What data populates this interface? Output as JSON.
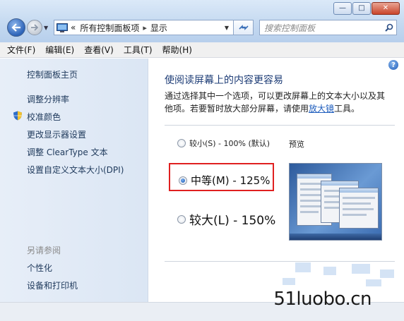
{
  "window": {
    "minimize_glyph": "—",
    "maximize_glyph": "□",
    "close_glyph": "✕"
  },
  "nav": {
    "breadcrumb_sep": "«",
    "breadcrumb_1": "所有控制面板项",
    "breadcrumb_arrow": "▸",
    "breadcrumb_2": "显示",
    "search_placeholder": "搜索控制面板"
  },
  "menu": {
    "file": "文件(F)",
    "edit": "编辑(E)",
    "view": "查看(V)",
    "tools": "工具(T)",
    "help": "帮助(H)"
  },
  "sidebar": {
    "home": "控制面板主页",
    "resolution": "调整分辨率",
    "calibrate": "校准颜色",
    "display_settings": "更改显示器设置",
    "cleartype": "调整 ClearType 文本",
    "custom_dpi": "设置自定义文本大小(DPI)",
    "see_also": "另请参阅",
    "personalize": "个性化",
    "devices": "设备和打印机"
  },
  "main": {
    "title": "使阅读屏幕上的内容更容易",
    "desc_part1": "通过选择其中一个选项，可以更改屏幕上的文本大小以及其他项。若要暂时放大部分屏幕，请使用",
    "desc_link": "放大镜",
    "desc_part2": "工具。",
    "preview_label": "预览",
    "options": {
      "small": "较小(S) - 100% (默认)",
      "medium": "中等(M) - 125%",
      "large": "较大(L) - 150%"
    },
    "selected": "medium"
  },
  "watermark": "51luobo.cn",
  "colors": {
    "accent": "#1d3c76",
    "highlight_box": "#e02020",
    "link": "#1e5dbd"
  }
}
